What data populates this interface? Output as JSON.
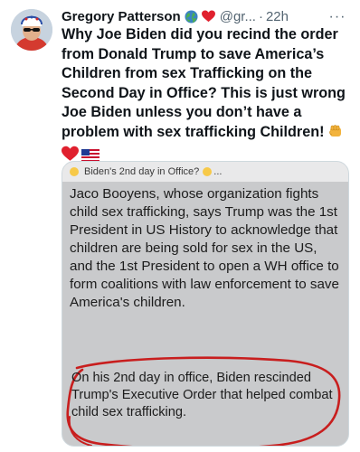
{
  "tweet": {
    "author_name": "Gregory Patterson",
    "handle": "@gr...",
    "separator": "·",
    "time": "22h",
    "more": "···",
    "text": "Why Joe Biden did you recind the order from Donald Trump to save America’s Children from sex Trafficking  on the Second Day in Office? This is just wrong Joe Biden unless you don’t have a problem with sex trafficking Children!",
    "emoji_icons": [
      "globe-icon",
      "red-heart-icon",
      "fist-icon",
      "red-heart-icon",
      "us-flag-icon"
    ]
  },
  "media": {
    "header_caption": "Biden's 2nd day in Office?",
    "header_suffix": "...",
    "paragraph_1": "Jaco Booyens, whose organization fights child sex trafficking, says Trump was the 1st President in US History to acknowledge that children are being sold for sex in the US, and the 1st President to open a WH office to form coalitions with law enforcement to save America's children.",
    "paragraph_2": "On his 2nd day in office, Biden rescinded Trump's Executive Order that helped combat child sex trafficking.",
    "annotation_color": "#c81e1e"
  },
  "colors": {
    "text": "#0f1419",
    "secondary": "#536471",
    "heart": "#f91880"
  }
}
